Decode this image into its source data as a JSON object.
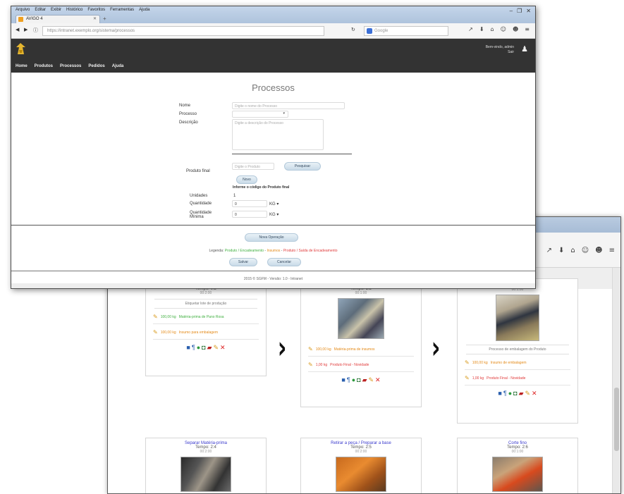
{
  "browser": {
    "menu": [
      "Arquivo",
      "Editar",
      "Exibir",
      "Histórico",
      "Favoritos",
      "Ferramentas",
      "Ajuda"
    ],
    "tab_title": "AVIGO 4",
    "url": "https://intranet.exemplo.org/sistema/processos",
    "search_placeholder": "Google",
    "window_buttons": [
      "–",
      "❐",
      "✕"
    ]
  },
  "app": {
    "user_text": "Bem-vindo, admin",
    "user_sub": "Sair",
    "menu": [
      "Home",
      "Produtos",
      "Processos",
      "Pedidos",
      "Ajuda"
    ]
  },
  "form": {
    "title": "Processos",
    "nome_label": "Nome",
    "nome_placeholder": "Digite o nome do Processo",
    "processo_label": "Processo",
    "descricao_label": "Descrição",
    "descricao_placeholder": "Digite a descrição do Processo",
    "produto_label": "Produto final",
    "produto_placeholder": "Digite o Produto",
    "pesquisar_button": "Pesquisar",
    "novo_button": "Novo",
    "informe_text": "Informe o código do Produto final",
    "unidades_label": "Unidades",
    "unidades_value": "1",
    "quantidade_label": "Quantidade",
    "quantidade_value": "0",
    "quantidade_unit": "KG",
    "qtd_minima_label": "Quantidade Mínima",
    "qtd_minima_value": "0",
    "qtd_minima_unit": "KG",
    "nova_operacao_button": "Nova Operação",
    "legenda_label": "Legenda:",
    "legend_green": "Produto / Encadeamento",
    "legend_orange": "Insumos",
    "legend_red": "Produto / Saída de Encadeamento",
    "salvar_button": "Salvar",
    "cancelar_button": "Cancelar",
    "footer": "2015 © SGFM - Versão: 1.0 - Intranet"
  },
  "flow": {
    "cards": [
      {
        "title": "",
        "time": "Tempo: 0:2",
        "dur": "00:2:00",
        "desc": "Etiquetar lote de produção",
        "lines": [
          {
            "kind": "green",
            "qty": "100,00 kg",
            "text": "Matéria-prima de Pano Rosa"
          },
          {
            "kind": "orange",
            "qty": "100,00 kg",
            "text": "Insumo para embalagem"
          }
        ]
      },
      {
        "title": "",
        "time": "Tempo: 1:2",
        "dur": "00:1:00",
        "desc": "",
        "lines": [
          {
            "kind": "orange",
            "qty": "100,00 kg",
            "text": "Matéria-prima de insumos"
          },
          {
            "kind": "red",
            "qty": "1,00 kg",
            "text": "Produto Final - Novidade"
          }
        ]
      },
      {
        "title": "",
        "time": "Tempo: 2:2",
        "dur": "00:1:00",
        "desc": "Processo de embalagem do Produto",
        "lines": [
          {
            "kind": "orange",
            "qty": "100,00 kg",
            "text": "Insumo de embalagem"
          },
          {
            "kind": "red",
            "qty": "1,00 kg",
            "text": "Produto Final - Novidade"
          }
        ]
      },
      {
        "title": "Separar Matéria-prima",
        "time": "Tempo: 2:4",
        "dur": "00:2:00"
      },
      {
        "title": "Retirar a peça / Preparar a base",
        "time": "Tempo: 2:5",
        "dur": "00:2:00"
      },
      {
        "title": "Corte fino",
        "time": "Tempo: 2:6",
        "dur": "00:1:00"
      }
    ],
    "action_icons": [
      "save-icon",
      "pin-icon",
      "globe-icon",
      "copy-icon",
      "book-icon",
      "edit-icon",
      "delete-icon"
    ]
  }
}
